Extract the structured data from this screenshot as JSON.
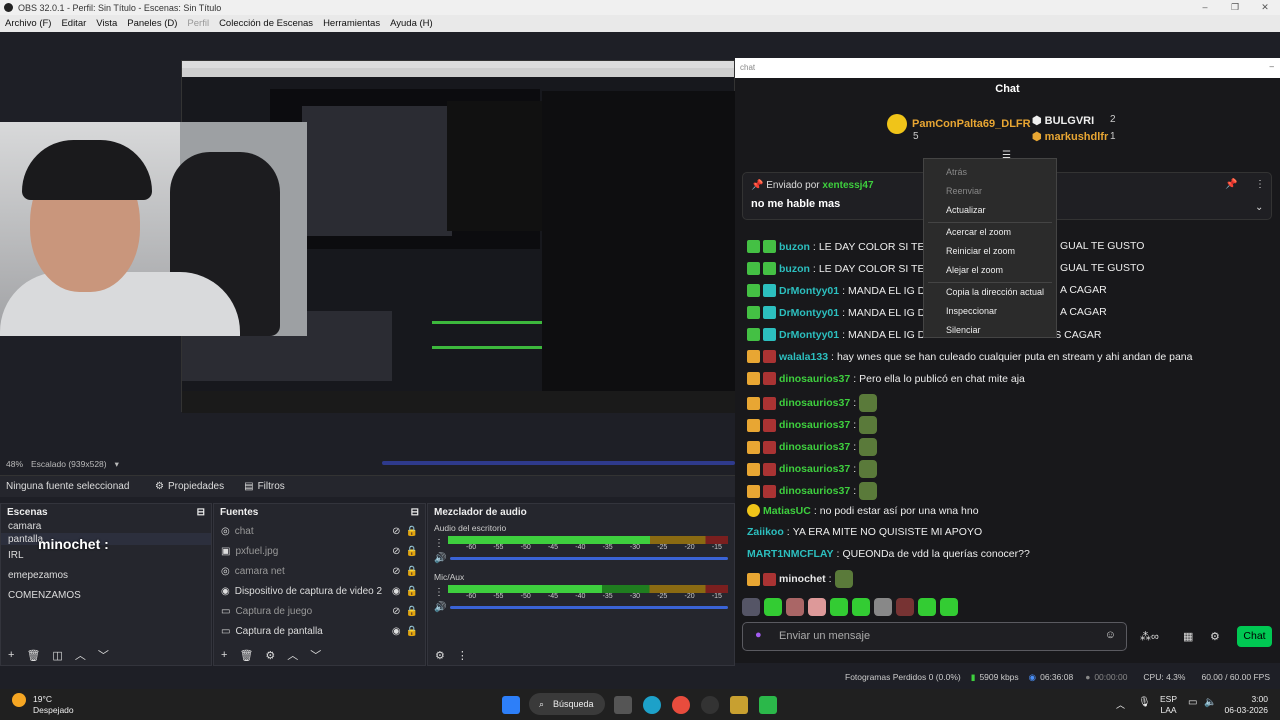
{
  "window": {
    "title": "OBS 32.0.1 - Perfil: Sin Título - Escenas: Sin Título",
    "controls": [
      "–",
      "❐",
      "✕"
    ]
  },
  "menu": {
    "items": [
      "Archivo (F)",
      "Editar",
      "Vista",
      "Paneles (D)",
      "Perfil",
      "Colección de Escenas",
      "Herramientas",
      "Ayuda (H)"
    ]
  },
  "preview": {
    "zoom": "48%",
    "scale": "Escalado (939x528)",
    "overlay_user": "minochet :"
  },
  "source_bar": {
    "no_source": "Ninguna fuente seleccionad",
    "properties": "Propiedades",
    "filters": "Filtros"
  },
  "scenes": {
    "title": "Escenas",
    "items": [
      "camara",
      "pantalla",
      "IRL",
      "emepezamos",
      "COMENZAMOS"
    ]
  },
  "sources": {
    "title": "Fuentes",
    "items": [
      {
        "name": "chat",
        "visible": false
      },
      {
        "name": "pxfuel.jpg",
        "visible": false
      },
      {
        "name": "camara net",
        "visible": false
      },
      {
        "name": "Dispositivo de captura de video 2",
        "visible": true
      },
      {
        "name": "Captura de juego",
        "visible": false
      },
      {
        "name": "Captura de pantalla",
        "visible": true
      }
    ]
  },
  "mixer": {
    "title": "Mezclador de audio",
    "tracks": [
      {
        "name": "Audio del escritorio",
        "level": 0.72
      },
      {
        "name": "Mic/Aux",
        "level": 0.55
      }
    ],
    "ticks": [
      "-60",
      "-55",
      "-50",
      "-45",
      "-40",
      "-35",
      "-30",
      "-25",
      "-20",
      "-15"
    ]
  },
  "chat_window": {
    "titlebar": "chat",
    "header": "Chat",
    "leaders": [
      {
        "name": "PamConPalta69_DLFR",
        "count": "5"
      },
      {
        "name": "BULGVRI",
        "count": "2"
      },
      {
        "name": "markushdlfr",
        "count": "1"
      }
    ],
    "pinned": {
      "label": "Enviado por",
      "user": "xentessj47",
      "text": "no me hable mas"
    },
    "context_menu": {
      "items": [
        {
          "label": "Atrás",
          "disabled": true
        },
        {
          "label": "Reenviar",
          "disabled": true
        },
        {
          "label": "Actualizar",
          "disabled": false
        },
        {
          "label": "Acercar el zoom",
          "disabled": false
        },
        {
          "label": "Reiniciar el zoom",
          "disabled": false
        },
        {
          "label": "Alejar el zoom",
          "disabled": false
        },
        {
          "label": "Copia la dirección actual",
          "disabled": false
        },
        {
          "label": "Inspeccionar",
          "disabled": false
        },
        {
          "label": "Silenciar",
          "disabled": false
        }
      ]
    },
    "messages": [
      {
        "user": "buzon",
        "text": "LE DAY COLOR SI TE FU",
        "tail": "GUAL TE GUSTO",
        "color": "#2cbfbf"
      },
      {
        "user": "buzon",
        "text": "LE DAY COLOR SI TE FU",
        "tail": "GUAL TE GUSTO",
        "color": "#2cbfbf"
      },
      {
        "user": "DrMontyy01",
        "text": "MANDA EL IG DE L",
        "tail": "A CAGAR",
        "color": "#2cbfbf"
      },
      {
        "user": "DrMontyy01",
        "text": "MANDA EL IG DE L",
        "tail": "A CAGAR",
        "color": "#2cbfbf"
      },
      {
        "user": "DrMontyy01",
        "text": "MANDA EL IG DE LA ALTA PA LA HAGAMOS CAGAR",
        "tail": "",
        "color": "#2cbfbf"
      },
      {
        "user": "walala133",
        "text": "hay wnes que se han culeado cualquier puta en stream y ahi andan de pana",
        "tail": "",
        "color": "#2cbfbf"
      },
      {
        "user": "dinosaurios37",
        "text": "Pero ella lo publicó en chat mite aja",
        "tail": "",
        "color": "#3ecf3e"
      },
      {
        "user": "dinosaurios37",
        "text": "",
        "tail": "",
        "color": "#3ecf3e"
      },
      {
        "user": "dinosaurios37",
        "text": "",
        "tail": "",
        "color": "#3ecf3e"
      },
      {
        "user": "dinosaurios37",
        "text": "",
        "tail": "",
        "color": "#3ecf3e"
      },
      {
        "user": "dinosaurios37",
        "text": "",
        "tail": "",
        "color": "#3ecf3e"
      },
      {
        "user": "dinosaurios37",
        "text": "",
        "tail": "",
        "color": "#3ecf3e"
      },
      {
        "user": "MatiasUC",
        "text": "no podi estar así por una wna hno",
        "tail": "",
        "color": "#3ecf3e"
      },
      {
        "user": "Zaiikoo",
        "text": "YA ERA MITE NO QUISISTE MI APOYO",
        "tail": "",
        "color": "#2cbfbf"
      },
      {
        "user": "MART1NMCFLAY",
        "text": "QUEONDa de vdd la querías conocer??",
        "tail": "",
        "color": "#2cbfbf"
      },
      {
        "user": "minochet",
        "text": "",
        "tail": "",
        "color": "#e8e8e8"
      }
    ],
    "input_placeholder": "Enviar un mensaje",
    "chat_button": "Chat"
  },
  "status": {
    "dropped": "Fotogramas Perdidos 0 (0.0%)",
    "bitrate": "5909 kbps",
    "live_time": "06:36:08",
    "rec_time": "00:00:00",
    "cpu": "CPU: 4.3%",
    "fps": "60.00 / 60.00 FPS"
  },
  "taskbar": {
    "temp": "19°C",
    "weather": "Despejado",
    "search": "Búsqueda",
    "lang1": "ESP",
    "lang2": "LAA",
    "time": "3:00",
    "date": "06-03-2026"
  }
}
